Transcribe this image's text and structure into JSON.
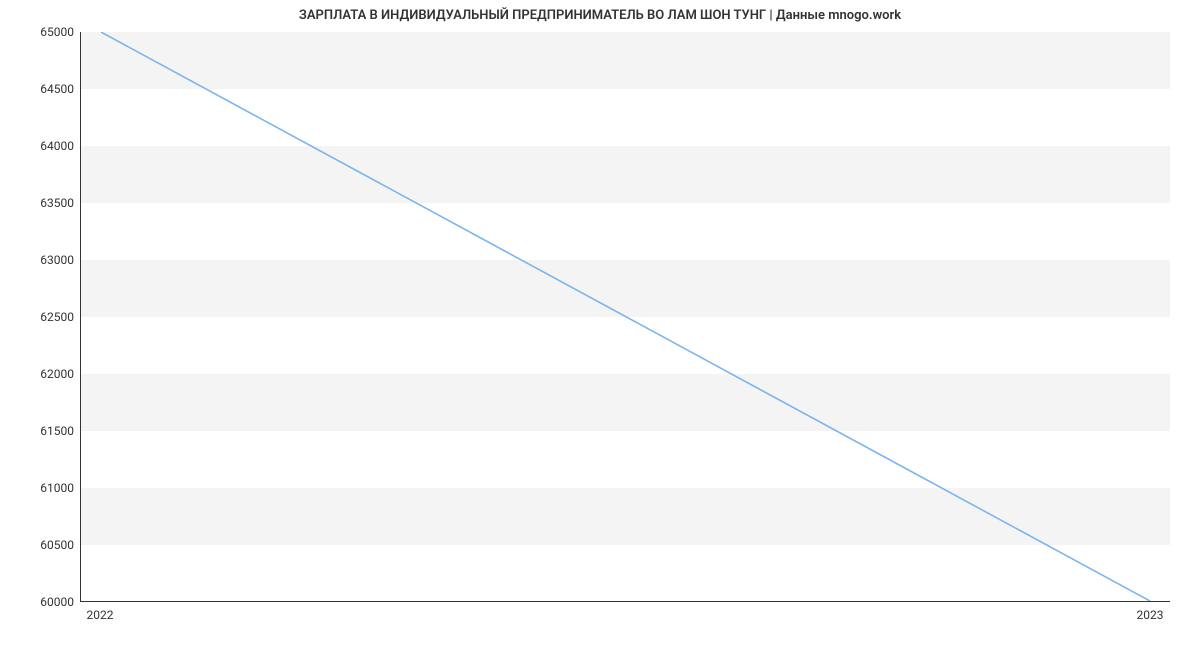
{
  "chart_data": {
    "type": "line",
    "title": "ЗАРПЛАТА В ИНДИВИДУАЛЬНЫЙ ПРЕДПРИНИМАТЕЛЬ ВО ЛАМ ШОН ТУНГ | Данные mnogo.work",
    "x": [
      "2022",
      "2023"
    ],
    "values": [
      65000,
      60000
    ],
    "xlabel": "",
    "ylabel": "",
    "ylim": [
      60000,
      65000
    ],
    "y_ticks": [
      60000,
      60500,
      61000,
      61500,
      62000,
      62500,
      63000,
      63500,
      64000,
      64500,
      65000
    ],
    "x_ticks": [
      "2022",
      "2023"
    ],
    "line_color": "#7cb5ec",
    "grid_band_color": "#f4f4f4"
  }
}
